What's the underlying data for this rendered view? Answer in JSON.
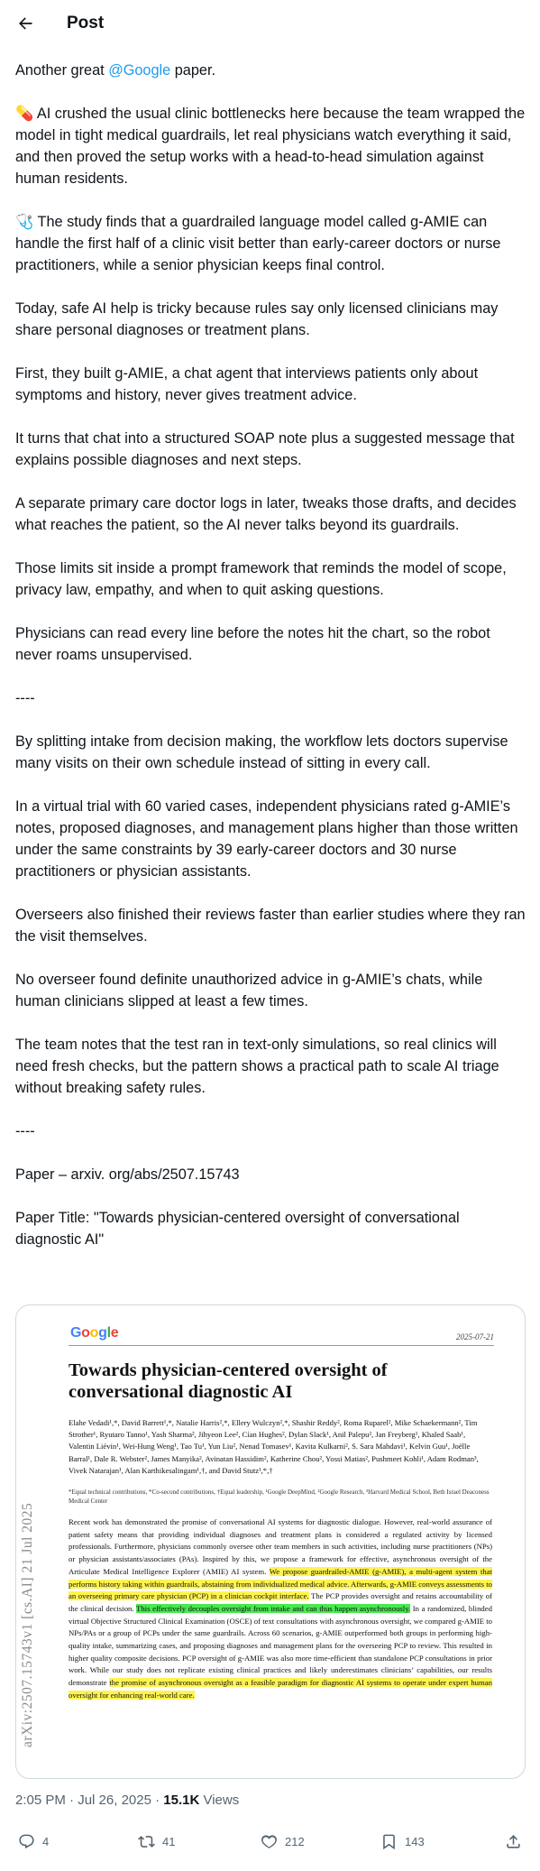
{
  "header": {
    "title": "Post"
  },
  "tweet": {
    "intro_prefix": "Another great ",
    "intro_mention": "@Google",
    "intro_suffix": " paper.",
    "paragraphs": [
      "💊 AI crushed the usual clinic bottlenecks here because the team wrapped the model in tight medical guardrails, let real physicians watch everything it said, and then proved the setup works with a head-to-head simulation against human residents.",
      "🩺 The study finds that a guardrailed language model called g-AMIE can handle the first half of a clinic visit better than early-career doctors or nurse practitioners, while a senior physician keeps final control.",
      "Today, safe AI help is tricky because rules say only licensed clinicians may share personal diagnoses or treatment plans.",
      "First, they built g-AMIE, a chat agent that interviews patients only about symptoms and history, never gives treatment advice.",
      "It turns that chat into a structured SOAP note plus a suggested message that explains possible diagnoses and next steps.",
      "A separate primary care doctor logs in later, tweaks those drafts, and decides what reaches the patient, so the AI never talks beyond its guardrails.",
      "Those limits sit inside a prompt framework that reminds the model of scope, privacy law, empathy, and when to quit asking questions.",
      "Physicians can read every line before the notes hit the chart, so the robot never roams unsupervised.",
      "----",
      "By splitting intake from decision making, the workflow lets doctors supervise many visits on their own schedule instead of sitting in every call.",
      "In a virtual trial with 60 varied cases, independent physicians rated g-AMIE’s notes, proposed diagnoses, and management plans higher than those written under the same constraints by 39 early-career doctors and 30 nurse practitioners or physician assistants.",
      "Overseers also finished their reviews faster than earlier studies where they ran the visit themselves.",
      "No overseer found definite unauthorized advice in g-AMIE’s chats, while human clinicians slipped at least a few times.",
      "The team notes that the test ran in text-only simulations, so real clinics will need fresh checks, but the pattern shows a practical path to scale AI triage without breaking safety rules.",
      "----",
      "Paper – arxiv. org/abs/2507.15743",
      "Paper Title: \"Towards physician-centered oversight of conversational diagnostic AI\""
    ]
  },
  "paper": {
    "logo": "Google",
    "date": "2025-07-21",
    "title": "Towards physician-centered oversight of conversational diagnostic AI",
    "authors": "Elahe Vedadi¹,*, David Barrett¹,*, Natalie Harris²,*, Ellery Wulczyn²,*, Shashir Reddy², Roma Ruparel², Mike Schaekermann², Tim Strother¹, Ryutaro Tanno¹, Yash Sharma², Jihyeon Lee², Cían Hughes², Dylan Slack¹, Anil Palepu², Jan Freyberg¹, Khaled Saab¹, Valentin Liévin¹, Wei-Hung Weng¹, Tao Tu¹, Yun Liu², Nenad Tomasev¹, Kavita Kulkarni², S. Sara Mahdavi¹, Kelvin Guu¹, Joëlle Barral¹, Dale R. Webster², James Manyika², Avinatan Hassidim², Katherine Chou², Yossi Matias², Pushmeet Kohli¹, Adam Rodman³, Vivek Natarajan¹, Alan Karthikesalingam¹,†, and David Stutz¹,*,†",
    "affiliations": "*Equal technical contributions, *Co-second contributions, †Equal leadership, ¹Google DeepMind, ²Google Research, ³Harvard Medical School, Beth Israel Deaconess Medical Center",
    "abstract_1": "Recent work has demonstrated the promise of conversational AI systems for diagnostic dialogue. However, real-world assurance of patient safety means that providing individual diagnoses and treatment plans is considered a regulated activity by licensed professionals. Furthermore, physicians commonly oversee other team members in such activities, including nurse practitioners (NPs) or physician assistants/associates (PAs). Inspired by this, we propose a framework for effective, asynchronous oversight of the Articulate Medical Intelligence Explorer (AMIE) AI system. ",
    "abstract_hl_1": "We propose guardrailed-AMIE (g-AMIE), a multi-agent system that performs history taking within guardrails, abstaining from individualized medical advice. Afterwards, g-AMIE conveys assessments to an overseeing primary care physician (PCP) in a clinician cockpit interface.",
    "abstract_2": " The PCP provides oversight and retains accountability of the clinical decision. ",
    "abstract_hl_2": "This effectively decouples oversight from intake and can thus happen asynchronously.",
    "abstract_3": " In a randomized, blinded virtual Objective Structured Clinical Examination (OSCE) of text consultations with asynchronous oversight, we compared g-AMIE to NPs/PAs or a group of PCPs under the same guardrails. Across 60 scenarios, g-AMIE outperformed both groups in performing high-quality intake, summarizing cases, and proposing diagnoses and management plans for the overseeing PCP to review. This resulted in higher quality composite decisions. PCP oversight of g-AMIE was also more time-efficient than standalone PCP consultations in prior work. While our study does not replicate existing clinical practices and likely underestimates clinicians’ capabilities, our results demonstrate ",
    "abstract_hl_3": "the promise of asynchronous oversight as a feasible paradigm for diagnostic AI systems to operate under expert human oversight for enhancing real-world care.",
    "arxiv_id": "arXiv:2507.15743v1  [cs.AI]  21 Jul 2025"
  },
  "meta": {
    "time": "2:05 PM",
    "sep": " · ",
    "date": "Jul 26, 2025",
    "views_count": "15.1K",
    "views_label": " Views"
  },
  "actions": {
    "replies": "4",
    "reposts": "41",
    "likes": "212",
    "bookmarks": "143"
  },
  "colors": {
    "accent": "#1d9bf0",
    "text": "#0f1419",
    "muted": "#536471",
    "highlight_yellow": "#fff44f",
    "highlight_green": "#48e850"
  }
}
